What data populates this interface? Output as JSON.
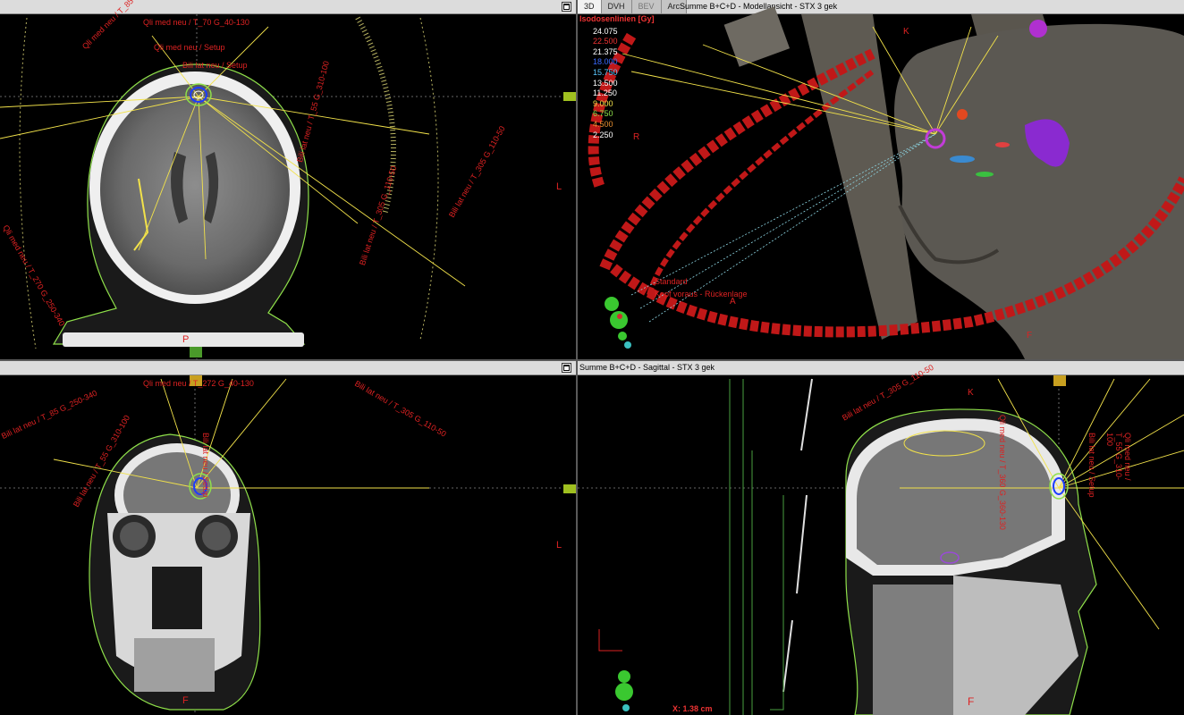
{
  "panes": {
    "axial": {
      "orientation_right": "L",
      "orientation_bottom": "P",
      "beam_labels": [
        "Bili lat neu / T_305 G_110-50",
        "Bili lat neu / T_55 G_310-100",
        "Qli med neu / T_270 G_250-340",
        "Qli med neu / Setup",
        "Bili lat neu / Setup",
        "Qli med neu / T_70 G_40-130",
        "Bili lat neu / T_305 G_110-50",
        "Qli med neu / T_85 G_250-340"
      ]
    },
    "model": {
      "tabs": [
        "3D",
        "DVH",
        "BEV",
        "Arc"
      ],
      "title": "Summe B+C+D - Modellansicht - STX 3 gek",
      "isodose_header": "Isodosenlinien [Gy]",
      "isodose_values": [
        "24.075",
        "22.500",
        "21.375",
        "18.000",
        "15.750",
        "13.500",
        "11.250",
        "9.000",
        "6.750",
        "4.500",
        "2.250"
      ],
      "label_standard": "Standard",
      "label_position": "Kopf voraus - Rückenlage",
      "orient_k": "K",
      "orient_a": "A",
      "orient_f": "F",
      "orient_r": "R"
    },
    "coronal": {
      "orientation_right": "L",
      "orientation_p": "P",
      "orientation_bottom": "F",
      "beam_labels": [
        "Bili lat neu / T_85 G_250-340",
        "Qli med neu / T_272 G_40-130",
        "Bili lat neu / T_305 G_110-50",
        "Bili lat neu / T_55 G_310-100",
        "Bili lat neu / Setup"
      ]
    },
    "sagittal": {
      "title": "Summe B+C+D - Sagittal - STX 3 gek",
      "orient_k": "K",
      "orient_f": "F",
      "readout": "X: 1.38 cm",
      "beam_labels": [
        "Bili lat neu / T_305 G_110-50",
        "Qli med neu / T_360 G_360-130",
        "Bili lat neu / Setup",
        "Qli med neu / T_55 G_310-100"
      ]
    }
  },
  "colors": {
    "structure_red": "#d22222",
    "contour_green": "#8fe04a",
    "beam_yellow": "#f2e24a",
    "isocenter_blue": "#1c3cff",
    "ptv_magenta": "#c23cd8"
  }
}
